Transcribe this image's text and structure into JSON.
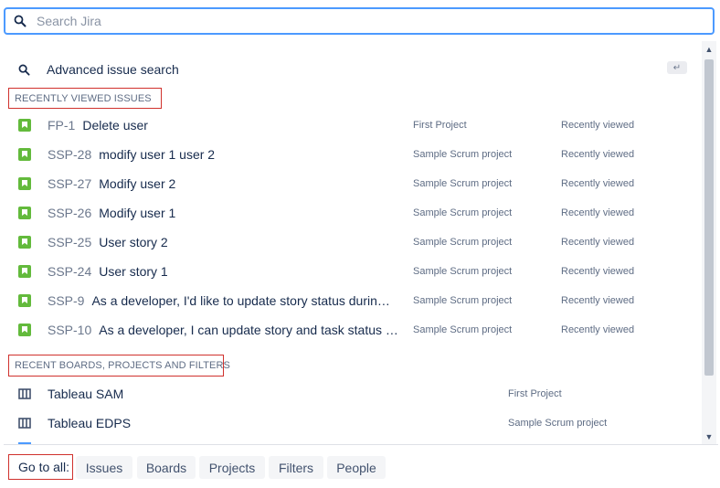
{
  "search": {
    "placeholder": "Search Jira"
  },
  "advanced": {
    "label": "Advanced issue search",
    "enter_key": "↵"
  },
  "sections": {
    "issues_header": "RECENTLY VIEWED ISSUES",
    "boards_header": "RECENT BOARDS, PROJECTS AND FILTERS"
  },
  "issues": [
    {
      "key": "FP-1",
      "summary": "Delete user",
      "project": "First Project",
      "status": "Recently viewed"
    },
    {
      "key": "SSP-28",
      "summary": "modify user 1 user 2",
      "project": "Sample Scrum project",
      "status": "Recently viewed"
    },
    {
      "key": "SSP-27",
      "summary": "Modify user 2",
      "project": "Sample Scrum project",
      "status": "Recently viewed"
    },
    {
      "key": "SSP-26",
      "summary": "Modify user 1",
      "project": "Sample Scrum project",
      "status": "Recently viewed"
    },
    {
      "key": "SSP-25",
      "summary": "User story 2",
      "project": "Sample Scrum project",
      "status": "Recently viewed"
    },
    {
      "key": "SSP-24",
      "summary": "User story 1",
      "project": "Sample Scrum project",
      "status": "Recently viewed"
    },
    {
      "key": "SSP-9",
      "summary": "As a developer, I'd like to update story status during the sprint >> Click the Active sprints link at the top right of the screen.",
      "project": "Sample Scrum project",
      "status": "Recently viewed"
    },
    {
      "key": "SSP-10",
      "summary": "As a developer, I can update story and task status with drag and drop",
      "project": "Sample Scrum project",
      "status": "Recently viewed"
    }
  ],
  "boards": [
    {
      "name": "Tableau SAM",
      "project": "First Project"
    },
    {
      "name": "Tableau EDPS",
      "project": "Sample Scrum project"
    }
  ],
  "footer": {
    "goto_label": "Go to all:",
    "chips": [
      "Issues",
      "Boards",
      "Projects",
      "Filters",
      "People"
    ]
  },
  "colors": {
    "focus_border": "#4c9aff",
    "story_green": "#63ba3c",
    "annotation_red": "#d0312d"
  }
}
